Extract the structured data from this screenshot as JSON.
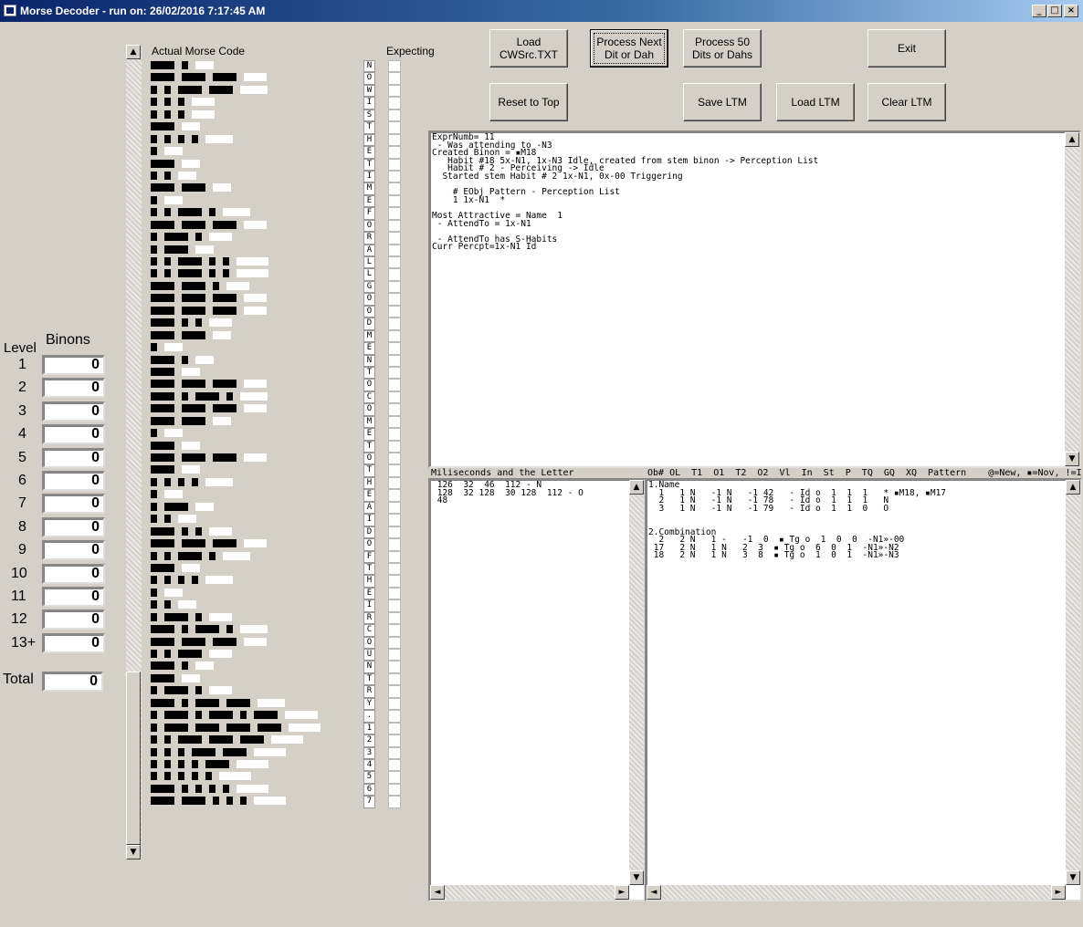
{
  "window": {
    "title": "Morse Decoder - run on: 26/02/2016  7:17:45 AM",
    "buttons": [
      "_",
      "□",
      "×"
    ]
  },
  "levels": {
    "level_label": "Level",
    "binons_label": "Binons",
    "rows": [
      {
        "level": "1",
        "value": "0"
      },
      {
        "level": "2",
        "value": "0"
      },
      {
        "level": "3",
        "value": "0"
      },
      {
        "level": "4",
        "value": "0"
      },
      {
        "level": "5",
        "value": "0"
      },
      {
        "level": "6",
        "value": "0"
      },
      {
        "level": "7",
        "value": "0"
      },
      {
        "level": "8",
        "value": "0"
      },
      {
        "level": "9",
        "value": "0"
      },
      {
        "level": "10",
        "value": "0"
      },
      {
        "level": "11",
        "value": "0"
      },
      {
        "level": "12",
        "value": "0"
      },
      {
        "level": "13+",
        "value": "0"
      }
    ],
    "total_label": "Total",
    "total_value": "0"
  },
  "morse_header": "Actual Morse Code",
  "expecting_header": "Expecting",
  "morse_code": [
    "-.",
    "---",
    "..--",
    "...",
    "...",
    "-",
    "....",
    ".",
    "-",
    "..",
    "--",
    ".",
    "..-.",
    "---",
    ".-.",
    ".-",
    "..-..",
    "..-..",
    "--.",
    "---",
    "---",
    "-..",
    "--",
    ".",
    "-.",
    "-",
    "---",
    "-.-.",
    "---",
    "--",
    ".",
    "-",
    "---",
    "-",
    "....",
    ".",
    ".-",
    "..",
    "-..",
    "---",
    "..-.",
    "-",
    "....",
    ".",
    "..",
    ".-.",
    "-.-.",
    "---",
    "..-",
    "-.",
    "-",
    ".-.",
    "-.--",
    ".-.-.-",
    ".----",
    "..---",
    "...--",
    "....-",
    ".....",
    "-....",
    "--..."
  ],
  "letters": [
    "N",
    "O",
    "W",
    "I",
    "S",
    "T",
    "H",
    "E",
    "T",
    "I",
    "M",
    "E",
    "F",
    "O",
    "R",
    "A",
    "L",
    "L",
    "G",
    "O",
    "O",
    "D",
    "M",
    "E",
    "N",
    "T",
    "O",
    "C",
    "O",
    "M",
    "E",
    "T",
    "O",
    "T",
    "H",
    "E",
    "A",
    "I",
    "D",
    "O",
    "F",
    "T",
    "H",
    "E",
    "I",
    "R",
    "C",
    "O",
    "U",
    "N",
    "T",
    "R",
    "Y",
    ".",
    "1",
    "2",
    "3",
    "4",
    "5",
    "6",
    "7"
  ],
  "buttons": {
    "load": "Load CWSrc.TXT",
    "process_next": "Process Next Dit or Dah",
    "process_50": "Process 50 Dits or Dahs",
    "exit": "Exit",
    "reset": "Reset to Top",
    "save_ltm": "Save LTM",
    "load_ltm": "Load LTM",
    "clear_ltm": "Clear LTM"
  },
  "log_text": "ExprNumb= 11\n - Was attending to -N3\nCreated Binon = ▪M18\n   Habit #18 5x-N1, 1x-N3 Idle, created from stem binon -> Perception List\n   Habit # 2 - Perceiving -> Idle\n  Started stem Habit # 2 1x-N1, 0x-00 Triggering\n\n    # EObj Pattern - Perception List\n    1 1x-N1  *\n\nMost Attractive = Name  1\n - AttendTo = 1x-N1\n\n - AttendTo has S-Habits\nCurr Percpt=1x-N1 Id",
  "ms_header": "Miliseconds and the Letter",
  "ms_text": " 126  32  46  112 - N\n 128  32 128  30 128  112 - O\n 48",
  "obj_header": "Ob# OL  T1  O1  T2  O2  Vl  In  St  P  TQ  GQ  XQ  Pattern    @=New, ▪=Nov, !=Int, -=Fam",
  "obj_text": "1.Name\n  1   1 N   -1 N   -1 42   - Id o  1  1  1   * ▪M18, ▪M17\n  2   1 N   -1 N   -1 78   - Id o  1  1  1   N\n  3   1 N   -1 N   -1 79   - Id o  1  1  0   O\n\n\n2.Combination\n  2   2 N   1 -   -1  0  ▪ Tg o  1  0  0  -N1»-00\n 17   2 N   1 N   2  3  ▪ Tg o  6  0  1  -N1»-N2\n 18   2 N   1 N   3  8  ▪ Tg o  1  0  1  -N1»-N3"
}
